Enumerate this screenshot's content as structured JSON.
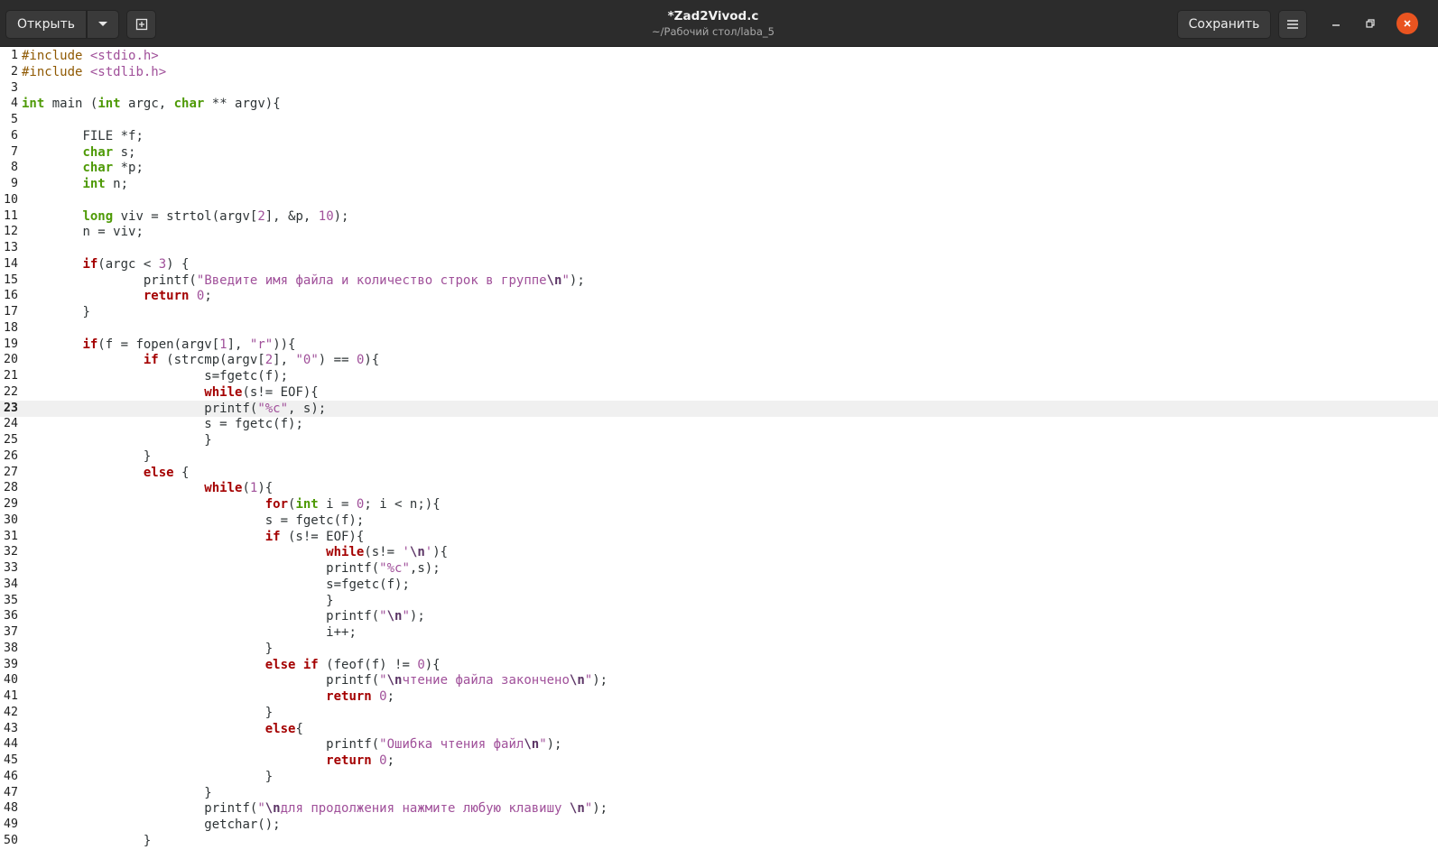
{
  "header": {
    "open_label": "Открыть",
    "save_label": "Сохранить",
    "title": "*Zad2Vivod.c",
    "subtitle": "~/Рабочий стол/laba_5"
  },
  "editor": {
    "current_line": 23,
    "lines": [
      "#include <stdio.h>",
      "#include <stdlib.h>",
      "",
      "int main (int argc, char ** argv){",
      "",
      "\tFILE *f;",
      "\tchar s;",
      "\tchar *p;",
      "\tint n;",
      "",
      "\tlong viv = strtol(argv[2], &p, 10);",
      "\tn = viv;",
      "",
      "\tif(argc < 3) {",
      "\t\tprintf(\"Введите имя файла и количество строк в группе\\n\");",
      "\t\treturn 0;",
      "\t}",
      "",
      "\tif(f = fopen(argv[1], \"r\")){",
      "\t\tif (strcmp(argv[2], \"0\") == 0){",
      "\t\t\ts=fgetc(f);",
      "\t\t\twhile(s!= EOF){",
      "\t\t\tprintf(\"%c\", s);",
      "\t\t\ts = fgetc(f);",
      "\t\t\t}",
      "\t\t}",
      "\t\telse {",
      "\t\t\twhile(1){",
      "\t\t\t\tfor(int i = 0; i < n;){",
      "\t\t\t\ts = fgetc(f);",
      "\t\t\t\tif (s!= EOF){",
      "\t\t\t\t\twhile(s!= '\\n'){",
      "\t\t\t\t\tprintf(\"%c\",s);",
      "\t\t\t\t\ts=fgetc(f);",
      "\t\t\t\t\t}",
      "\t\t\t\t\tprintf(\"\\n\");",
      "\t\t\t\t\ti++;",
      "\t\t\t\t}",
      "\t\t\t\telse if (feof(f) != 0){",
      "\t\t\t\t\tprintf(\"\\nчтение файла закончено\\n\");",
      "\t\t\t\t\treturn 0;",
      "\t\t\t\t}",
      "\t\t\t\telse{",
      "\t\t\t\t\tprintf(\"Ошибка чтения файл\\n\");",
      "\t\t\t\t\treturn 0;",
      "\t\t\t\t}",
      "\t\t\t}",
      "\t\t\tprintf(\"\\nдля продолжения нажмите любую клавишу \\n\");",
      "\t\t\tgetchar();",
      "\t\t}"
    ]
  }
}
